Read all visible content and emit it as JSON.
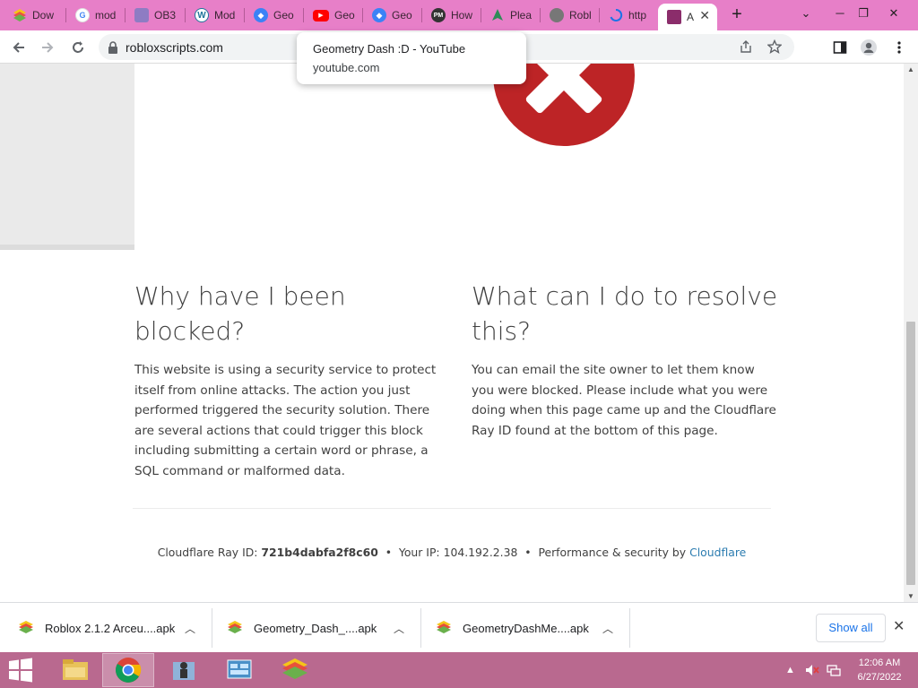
{
  "tabs": [
    {
      "title": "Dow",
      "icon": "bluestacks-icon",
      "color": "#6ab04c"
    },
    {
      "title": "mod",
      "icon": "google-icon",
      "color": "#4285f4"
    },
    {
      "title": "OB3",
      "icon": "ob3-icon",
      "color": "#8e7cc3"
    },
    {
      "title": "Mod",
      "icon": "wordpress-icon",
      "color": "#21759b"
    },
    {
      "title": "Geo",
      "icon": "geometry-icon",
      "color": "#3b82f6"
    },
    {
      "title": "Geo",
      "icon": "youtube-icon",
      "color": "#ff0000"
    },
    {
      "title": "Geo",
      "icon": "geometry-icon",
      "color": "#3b82f6"
    },
    {
      "title": "How",
      "icon": "pm-icon",
      "color": "#333333"
    },
    {
      "title": "Plea",
      "icon": "leaf-icon",
      "color": "#2e8b57"
    },
    {
      "title": "Robl",
      "icon": "roblox-icon",
      "color": "#777777"
    },
    {
      "title": "http",
      "icon": "loading-icon",
      "color": "#1a73e8"
    },
    {
      "title": "A",
      "icon": "site-icon",
      "color": "#8b2d6b",
      "active": true
    }
  ],
  "toolbar": {
    "url": "robloxscripts.com"
  },
  "tooltip": {
    "title": "Geometry Dash :D - YouTube",
    "url": "youtube.com"
  },
  "page": {
    "left_heading_line1": "Why have I been",
    "left_heading_line2": "blocked?",
    "left_para_lines": [
      "This website is using a security service to protect",
      "itself from online attacks. The action you just",
      "performed triggered the security solution. There",
      "are several actions that could trigger this block",
      "including submitting a certain word or phrase, a",
      "SQL command or malformed data."
    ],
    "right_heading_line1": "What can I do to resolve",
    "right_heading_line2": "this?",
    "right_para_lines": [
      "You can email the site owner to let them know",
      "you were blocked. Please include what you were",
      "doing when this page came up and the Cloudflare",
      "Ray ID found at the bottom of this page."
    ],
    "footer": {
      "ray_label": "Cloudflare Ray ID:",
      "ray_id": "721b4dabfa2f8c60",
      "ip_label": "Your IP:",
      "ip": "104.192.2.38",
      "perf_label": "Performance & security by",
      "cloudflare_link": "Cloudflare",
      "bullet": "•"
    }
  },
  "downloads": {
    "items": [
      {
        "name": "Roblox 2.1.2 Arceu....apk"
      },
      {
        "name": "Geometry_Dash_....apk"
      },
      {
        "name": "GeometryDashMe....apk"
      }
    ],
    "show_all": "Show all"
  },
  "taskbar": {
    "time": "12:06 AM",
    "date": "6/27/2022"
  },
  "colors": {
    "tabstrip": "#e77fc8",
    "taskbar": "#b9698f",
    "error_red": "#bd2426",
    "link_blue": "#2c7cb0"
  }
}
